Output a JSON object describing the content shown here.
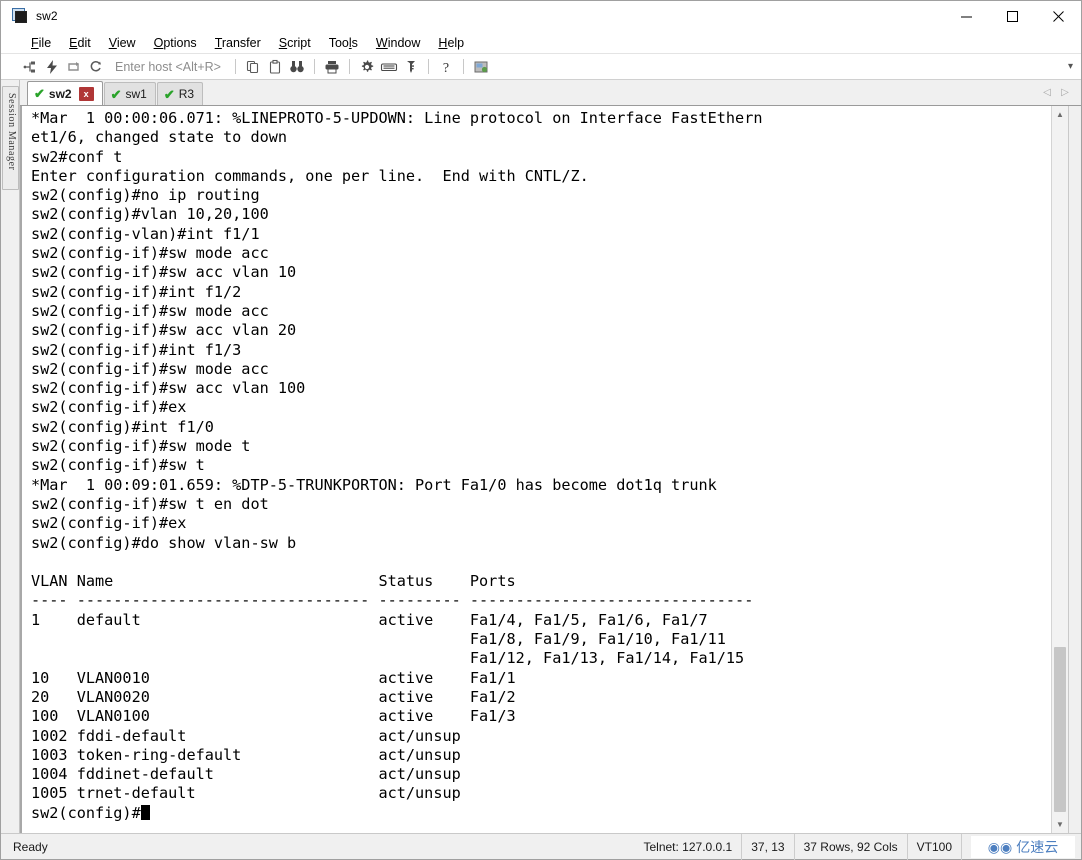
{
  "window": {
    "title": "sw2",
    "icon": "terminal-window-icon",
    "minimize_label": "—",
    "maximize_label": "□",
    "close_label": "✕"
  },
  "menu": {
    "items": [
      {
        "label": "File",
        "accel": "F"
      },
      {
        "label": "Edit",
        "accel": "E"
      },
      {
        "label": "View",
        "accel": "V"
      },
      {
        "label": "Options",
        "accel": "O"
      },
      {
        "label": "Transfer",
        "accel": "T"
      },
      {
        "label": "Script",
        "accel": "S"
      },
      {
        "label": "Tools",
        "accel": "l"
      },
      {
        "label": "Window",
        "accel": "W"
      },
      {
        "label": "Help",
        "accel": "H"
      }
    ]
  },
  "toolbar": {
    "host_placeholder": "Enter host <Alt+R>",
    "icons": [
      "connect-icon",
      "quick-connect-icon",
      "connect-in-tab-icon",
      "reconnect-icon",
      "copy-icon",
      "paste-icon",
      "find-icon",
      "print-icon",
      "settings-gear-icon",
      "keyboard-icon",
      "key-icon",
      "help-icon",
      "session-options-icon"
    ],
    "overflow_label": "▾"
  },
  "sidebar": {
    "session_manager_label": "Session Manager"
  },
  "tabs": {
    "items": [
      {
        "label": "sw2",
        "active": true,
        "status_icon": "green-check-icon",
        "close_label": "x"
      },
      {
        "label": "sw1",
        "active": false,
        "status_icon": "green-check-icon"
      },
      {
        "label": "R3",
        "active": false,
        "status_icon": "green-check-icon"
      }
    ],
    "nav_prev": "◁",
    "nav_next": "▷"
  },
  "terminal": {
    "content": "*Mar  1 00:00:06.071: %LINEPROTO-5-UPDOWN: Line protocol on Interface FastEthern\net1/6, changed state to down\nsw2#conf t\nEnter configuration commands, one per line.  End with CNTL/Z.\nsw2(config)#no ip routing\nsw2(config)#vlan 10,20,100\nsw2(config-vlan)#int f1/1\nsw2(config-if)#sw mode acc\nsw2(config-if)#sw acc vlan 10\nsw2(config-if)#int f1/2\nsw2(config-if)#sw mode acc\nsw2(config-if)#sw acc vlan 20\nsw2(config-if)#int f1/3\nsw2(config-if)#sw mode acc\nsw2(config-if)#sw acc vlan 100\nsw2(config-if)#ex\nsw2(config)#int f1/0\nsw2(config-if)#sw mode t\nsw2(config-if)#sw t\n*Mar  1 00:09:01.659: %DTP-5-TRUNKPORTON: Port Fa1/0 has become dot1q trunk\nsw2(config-if)#sw t en dot\nsw2(config-if)#ex\nsw2(config)#do show vlan-sw b\n\nVLAN Name                             Status    Ports\n---- -------------------------------- --------- -------------------------------\n1    default                          active    Fa1/4, Fa1/5, Fa1/6, Fa1/7\n                                                Fa1/8, Fa1/9, Fa1/10, Fa1/11\n                                                Fa1/12, Fa1/13, Fa1/14, Fa1/15\n10   VLAN0010                         active    Fa1/1\n20   VLAN0020                         active    Fa1/2\n100  VLAN0100                         active    Fa1/3\n1002 fddi-default                     act/unsup\n1003 token-ring-default               act/unsup\n1004 fddinet-default                  act/unsup\n1005 trnet-default                    act/unsup\n",
    "prompt": "sw2(config)#",
    "vlan_table": {
      "headers": [
        "VLAN",
        "Name",
        "Status",
        "Ports"
      ],
      "rows": [
        {
          "vlan": "1",
          "name": "default",
          "status": "active",
          "ports": "Fa1/4, Fa1/5, Fa1/6, Fa1/7 Fa1/8, Fa1/9, Fa1/10, Fa1/11 Fa1/12, Fa1/13, Fa1/14, Fa1/15"
        },
        {
          "vlan": "10",
          "name": "VLAN0010",
          "status": "active",
          "ports": "Fa1/1"
        },
        {
          "vlan": "20",
          "name": "VLAN0020",
          "status": "active",
          "ports": "Fa1/2"
        },
        {
          "vlan": "100",
          "name": "VLAN0100",
          "status": "active",
          "ports": "Fa1/3"
        },
        {
          "vlan": "1002",
          "name": "fddi-default",
          "status": "act/unsup",
          "ports": ""
        },
        {
          "vlan": "1003",
          "name": "token-ring-default",
          "status": "act/unsup",
          "ports": ""
        },
        {
          "vlan": "1004",
          "name": "fddinet-default",
          "status": "act/unsup",
          "ports": ""
        },
        {
          "vlan": "1005",
          "name": "trnet-default",
          "status": "act/unsup",
          "ports": ""
        }
      ]
    },
    "scroll_up": "▲",
    "scroll_down": "▼"
  },
  "statusbar": {
    "state": "Ready",
    "connection": "Telnet: 127.0.0.1",
    "cursor_position": "37, 13",
    "dimensions": "37 Rows, 92 Cols",
    "emulation": "VT100",
    "watermark": "亿速云"
  },
  "colors": {
    "accent": "#4d7fc0",
    "tab_close": "#b03636",
    "check_green": "#2aa32a",
    "terminal_bg": "#ffffff",
    "terminal_fg": "#000000"
  }
}
